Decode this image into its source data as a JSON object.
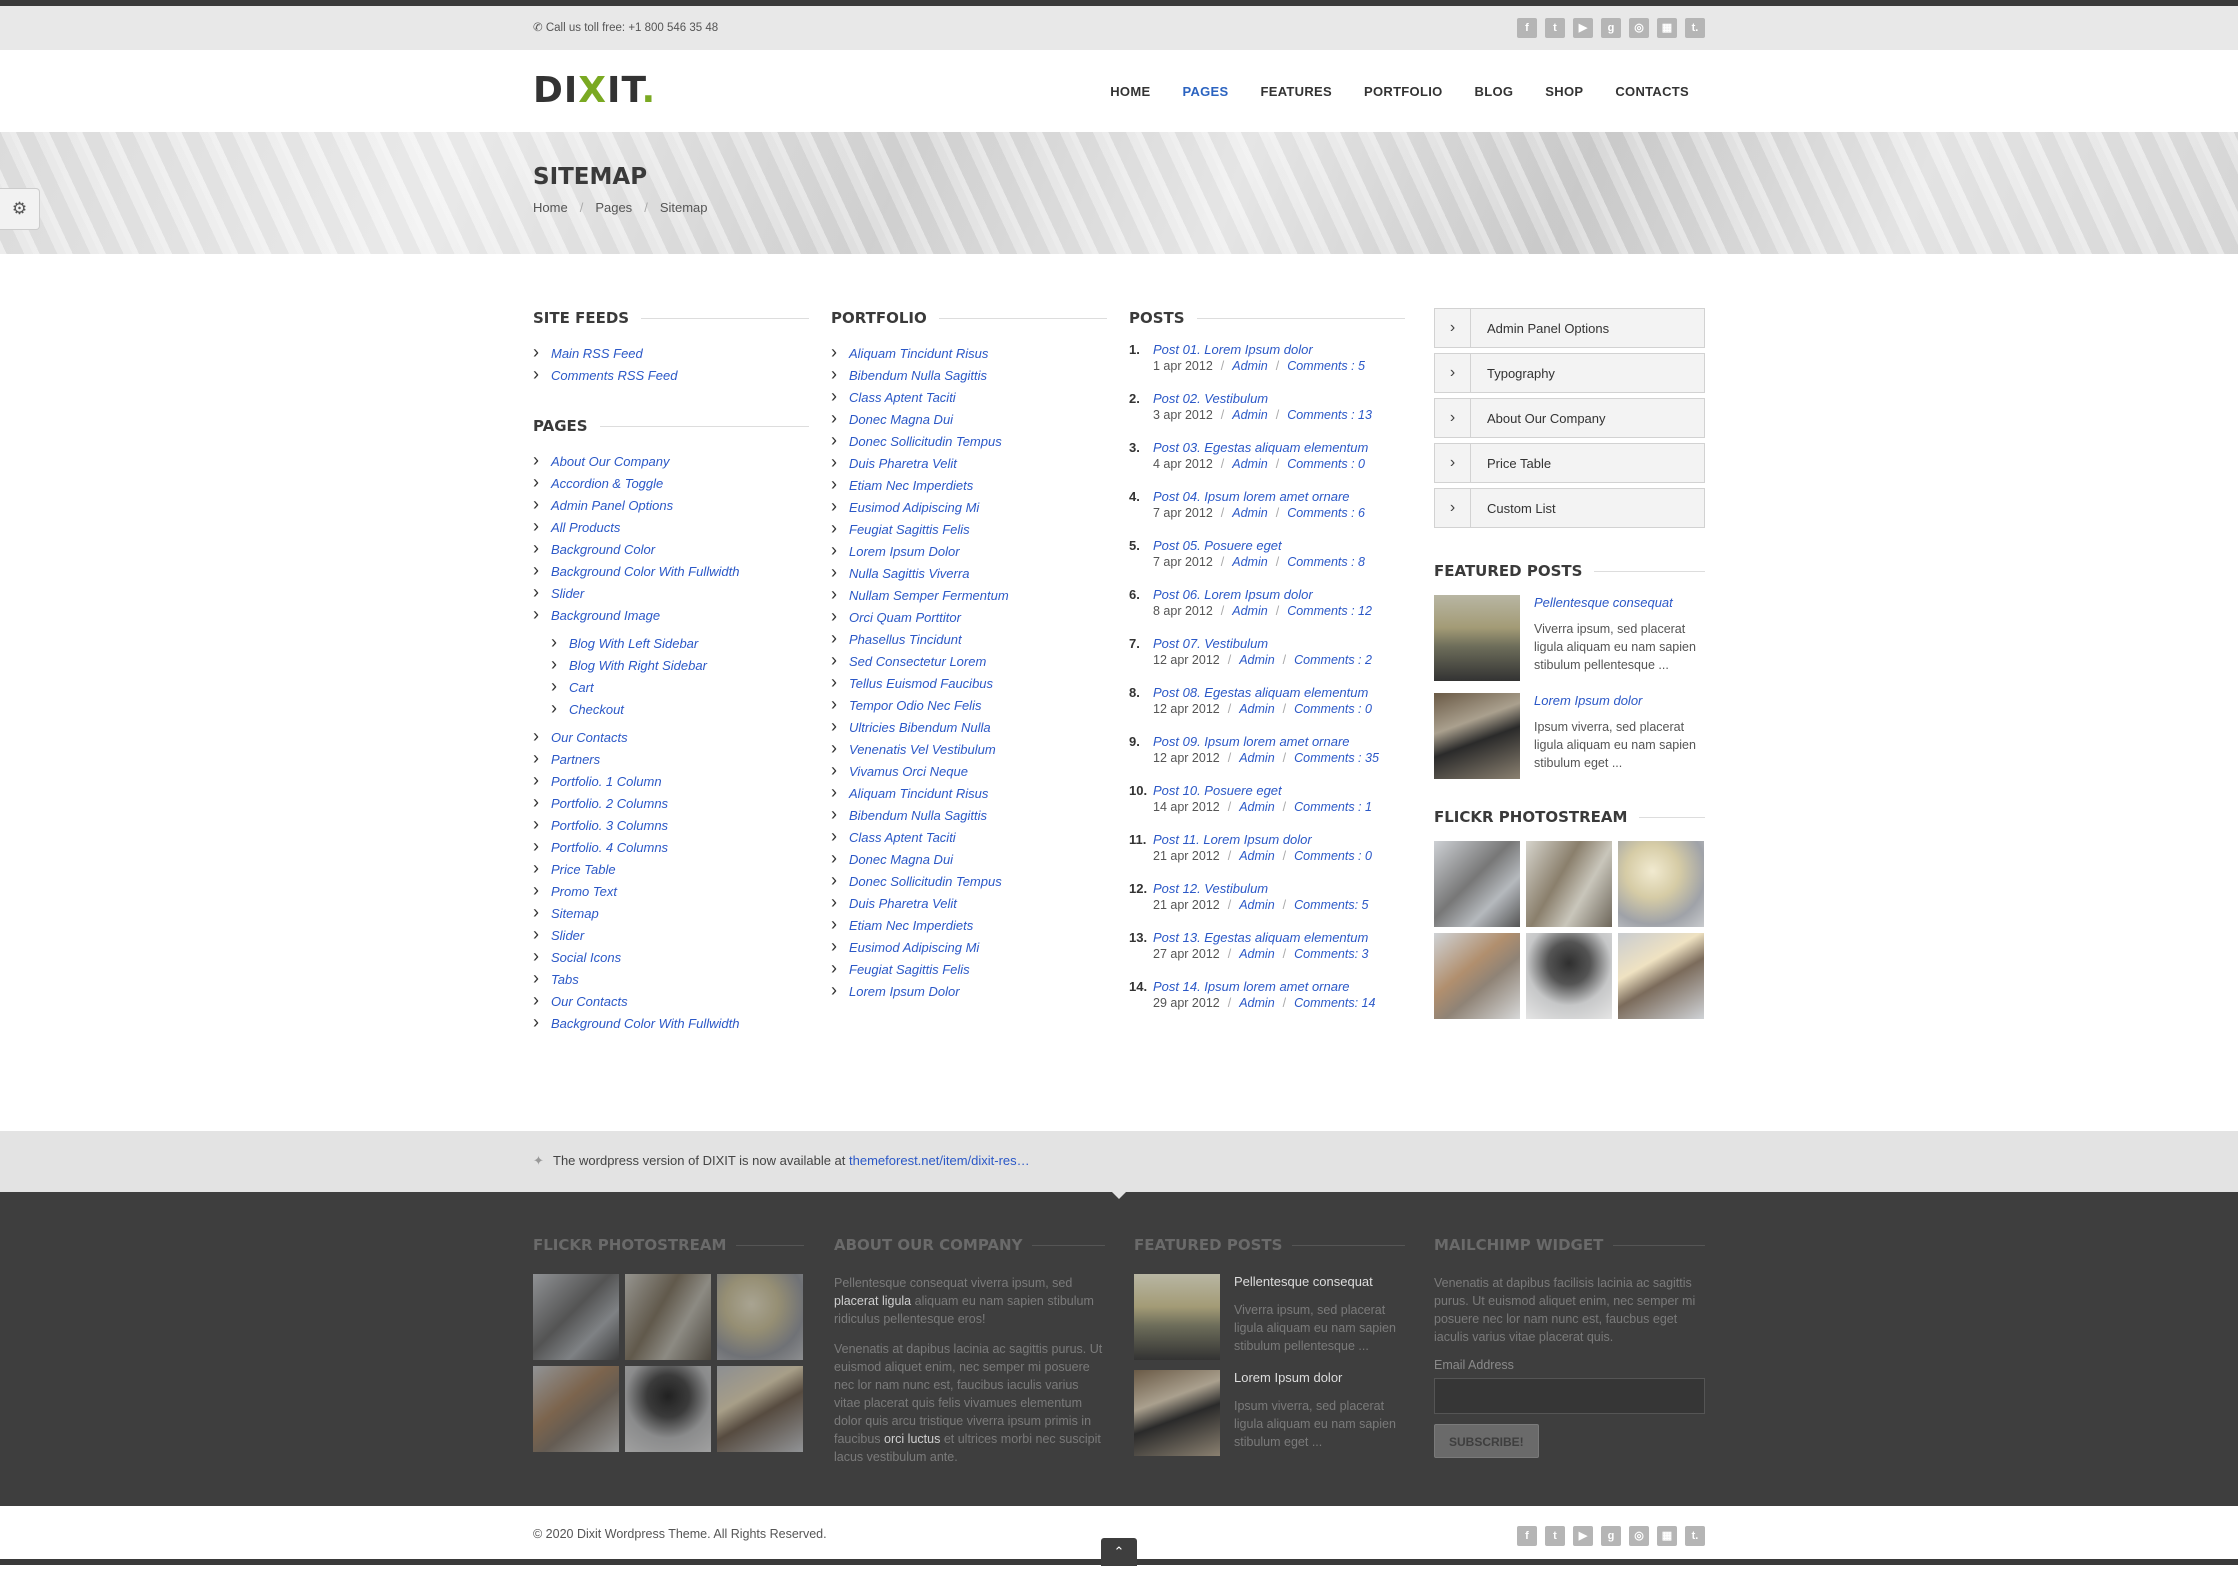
{
  "topbar": {
    "phone_label": "Call us toll free:",
    "phone": "+1 800 546 35 48"
  },
  "social_icons": [
    "facebook-icon",
    "twitter-icon",
    "youtube-icon",
    "googleplus-icon",
    "dribbble-icon",
    "delicious-icon",
    "tumblr-icon"
  ],
  "logo": {
    "main": "DI",
    "x": "X",
    "rest": "IT",
    "dot": "."
  },
  "nav": [
    "HOME",
    "PAGES",
    "FEATURES",
    "PORTFOLIO",
    "BLOG",
    "SHOP",
    "CONTACTS"
  ],
  "nav_active": "PAGES",
  "banner": {
    "title": "SITEMAP",
    "crumbs": [
      "Home",
      "Pages",
      "Sitemap"
    ],
    "sep": "/"
  },
  "site_feeds": {
    "title": "SITE FEEDS",
    "items": [
      "Main RSS Feed",
      "Comments RSS Feed"
    ]
  },
  "pages": {
    "title": "PAGES",
    "items": [
      "About Our Company",
      "Accordion & Toggle",
      "Admin Panel Options",
      "All Products",
      "Background Color",
      "Background Color With Fullwidth",
      "Slider",
      "Background Image"
    ],
    "sub_items": [
      "Blog With Left Sidebar",
      "Blog With Right Sidebar",
      "Cart",
      "Checkout"
    ],
    "items_after": [
      "Our Contacts",
      "Partners",
      "Portfolio. 1 Column",
      "Portfolio. 2 Columns",
      "Portfolio. 3 Columns",
      "Portfolio. 4 Columns",
      "Price Table",
      "Promo Text",
      "Sitemap",
      "Slider",
      "Social Icons",
      "Tabs",
      "Our Contacts",
      "Background Color With Fullwidth"
    ]
  },
  "portfolio": {
    "title": "PORTFOLIO",
    "items": [
      "Aliquam Tincidunt Risus",
      "Bibendum Nulla Sagittis",
      "Class Aptent Taciti",
      "Donec Magna Dui",
      "Donec Sollicitudin Tempus",
      "Duis Pharetra Velit",
      "Etiam Nec Imperdiets",
      "Eusimod Adipiscing Mi",
      "Feugiat Sagittis Felis",
      "Lorem Ipsum Dolor",
      "Nulla Sagittis Viverra",
      "Nullam Semper Fermentum",
      "Orci Quam Porttitor",
      "Phasellus Tincidunt",
      "Sed Consectetur Lorem",
      "Tellus Euismod Faucibus",
      "Tempor Odio Nec Felis",
      "Ultricies Bibendum Nulla",
      "Venenatis Vel Vestibulum",
      "Vivamus Orci Neque",
      "Aliquam Tincidunt Risus",
      "Bibendum Nulla Sagittis",
      "Class Aptent Taciti",
      "Donec Magna Dui",
      "Donec Sollicitudin Tempus",
      "Duis Pharetra Velit",
      "Etiam Nec Imperdiets",
      "Eusimod Adipiscing Mi",
      "Feugiat Sagittis Felis",
      "Lorem Ipsum Dolor"
    ]
  },
  "posts": {
    "title": "POSTS",
    "sep": "/",
    "items": [
      {
        "num": "1.",
        "title": "Post 01. Lorem Ipsum dolor",
        "date": "1 apr 2012",
        "author": "Admin",
        "comments": "Comments : 5"
      },
      {
        "num": "2.",
        "title": "Post 02. Vestibulum",
        "date": "3 apr 2012",
        "author": "Admin",
        "comments": "Comments : 13"
      },
      {
        "num": "3.",
        "title": "Post 03. Egestas aliquam elementum",
        "date": "4 apr 2012",
        "author": "Admin",
        "comments": "Comments : 0"
      },
      {
        "num": "4.",
        "title": "Post 04. Ipsum lorem amet ornare",
        "date": "7 apr 2012",
        "author": "Admin",
        "comments": "Comments : 6"
      },
      {
        "num": "5.",
        "title": "Post 05. Posuere eget",
        "date": "7 apr 2012",
        "author": "Admin",
        "comments": "Comments : 8"
      },
      {
        "num": "6.",
        "title": "Post 06. Lorem Ipsum dolor",
        "date": "8 apr 2012",
        "author": "Admin",
        "comments": "Comments : 12"
      },
      {
        "num": "7.",
        "title": "Post 07. Vestibulum",
        "date": "12 apr 2012",
        "author": "Admin",
        "comments": "Comments : 2"
      },
      {
        "num": "8.",
        "title": "Post 08. Egestas aliquam elementum",
        "date": "12 apr 2012",
        "author": "Admin",
        "comments": "Comments : 0"
      },
      {
        "num": "9.",
        "title": "Post 09. Ipsum lorem amet ornare",
        "date": "12 apr 2012",
        "author": "Admin",
        "comments": "Comments : 35"
      },
      {
        "num": "10.",
        "title": "Post 10. Posuere eget",
        "date": "14 apr 2012",
        "author": "Admin",
        "comments": "Comments : 1"
      },
      {
        "num": "11.",
        "title": "Post 11. Lorem Ipsum dolor",
        "date": "21 apr 2012",
        "author": "Admin",
        "comments": "Comments : 0"
      },
      {
        "num": "12.",
        "title": "Post 12. Vestibulum",
        "date": "21 apr 2012",
        "author": "Admin",
        "comments": "Comments: 5"
      },
      {
        "num": "13.",
        "title": "Post 13. Egestas aliquam elementum",
        "date": "27 apr 2012",
        "author": "Admin",
        "comments": "Comments: 3"
      },
      {
        "num": "14.",
        "title": "Post 14. Ipsum lorem amet ornare",
        "date": "29 apr 2012",
        "author": "Admin",
        "comments": "Comments: 14"
      }
    ]
  },
  "sidebar_menu": [
    "Admin Panel Options",
    "Typography",
    "About Our Company",
    "Price Table",
    "Custom List"
  ],
  "featured_posts": {
    "title": "FEATURED POSTS",
    "items": [
      {
        "title": "Pellentesque consequat",
        "text": "Viverra ipsum, sed placerat ligula aliquam eu nam sapien stibulum pellentesque ..."
      },
      {
        "title": "Lorem Ipsum dolor",
        "text": "Ipsum viverra, sed placerat ligula aliquam eu nam sapien stibulum eget ..."
      }
    ]
  },
  "flickr": {
    "title": "FLICKR PHOTOSTREAM"
  },
  "tweet": {
    "text": "The wordpress version of DIXIT is now available at",
    "link": "themeforest.net/item/dixit-res…"
  },
  "footer": {
    "flickr_title": "FLICKR PHOTOSTREAM",
    "about_title": "ABOUT OUR COMPANY",
    "about_p1_a": "Pellentesque consequat viverra ipsum, sed",
    "about_p1_b": "placerat ligula",
    "about_p1_c": "aliquam eu nam sapien stibulum ridiculus pellentesque eros!",
    "about_p2_a": "Venenatis at dapibus lacinia ac sagittis purus. Ut euismod aliquet enim, nec semper mi posuere nec lor nam nunc est, faucibus iaculis varius vitae placerat quis felis vivamues elementum dolor quis arcu tristique viverra ipsum primis in faucibus",
    "about_p2_b": "orci luctus",
    "about_p2_c": "et ultrices morbi nec suscipit lacus vestibulum ante.",
    "featured_title": "FEATURED POSTS",
    "featured": [
      {
        "title": "Pellentesque consequat",
        "text": "Viverra ipsum, sed placerat ligula aliquam eu nam sapien stibulum pellentesque ..."
      },
      {
        "title": "Lorem Ipsum dolor",
        "text": "Ipsum viverra, sed placerat ligula aliquam eu nam sapien stibulum eget ..."
      }
    ],
    "mail_title": "MAILCHIMP WIDGET",
    "mail_text": "Venenatis at dapibus facilisis lacinia ac sagittis purus. Ut euismod aliquet enim, nec semper mi posuere nec lor nam nunc est, faucbus eget iaculis varius vitae placerat quis.",
    "email_label": "Email Address",
    "subscribe": "SUBSCRIBE!"
  },
  "copyright": "© 2020 Dixit Wordpress Theme. All Rights Reserved.",
  "colors": {
    "accent": "#2b58c7",
    "logo_green": "#7aa922",
    "footer_bg": "#3e3e3e"
  }
}
